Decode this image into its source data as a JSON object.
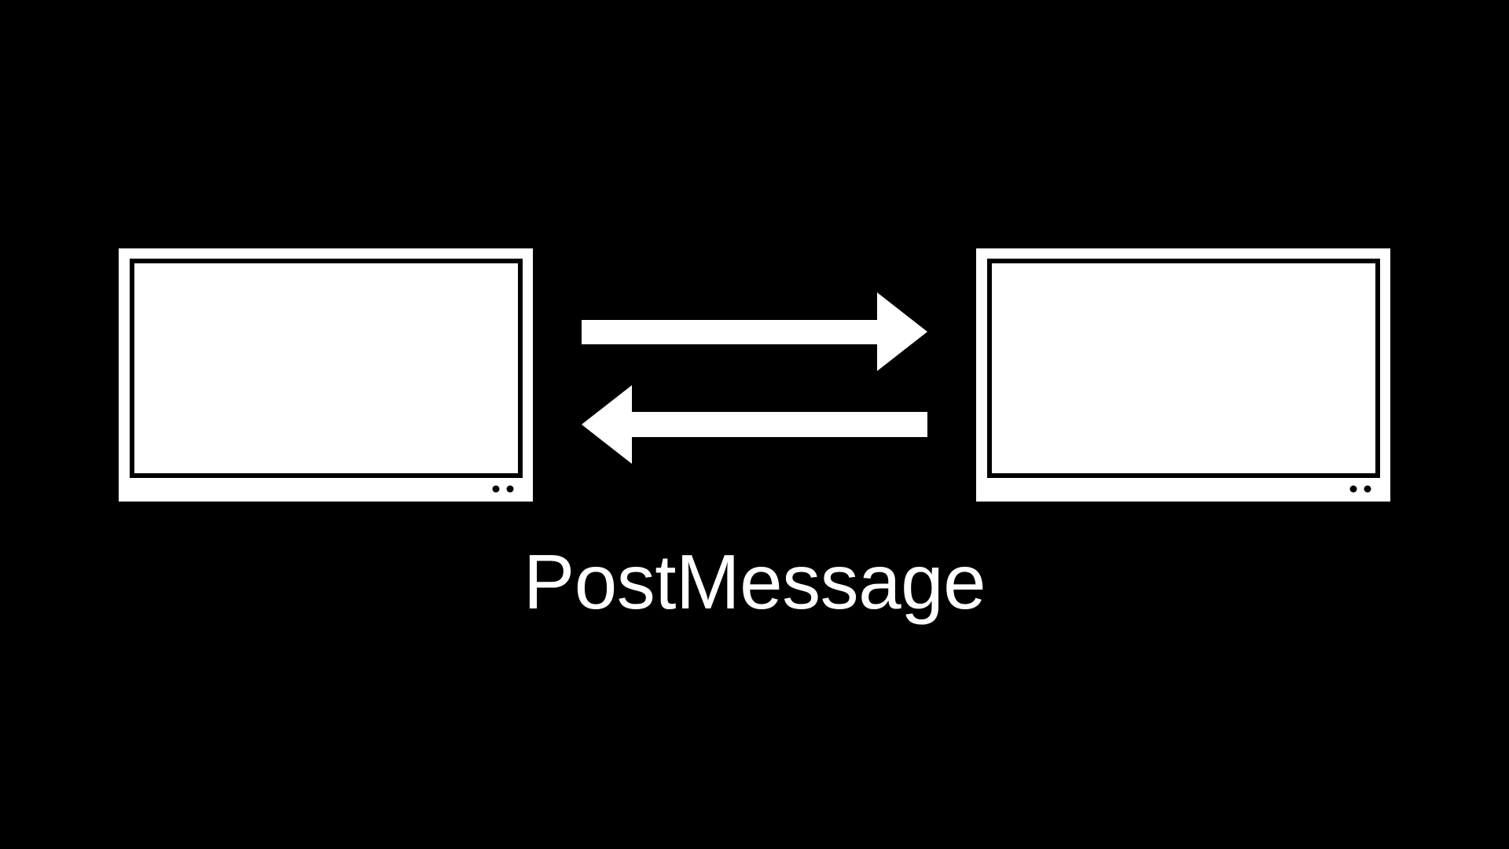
{
  "slide": {
    "caption": "PostMessage"
  },
  "diagram": {
    "nodes": [
      {
        "id": "window-left",
        "kind": "browser-window-icon"
      },
      {
        "id": "window-right",
        "kind": "browser-window-icon"
      }
    ],
    "edges": [
      {
        "from": "window-left",
        "to": "window-right",
        "direction": "right"
      },
      {
        "from": "window-right",
        "to": "window-left",
        "direction": "left"
      }
    ]
  },
  "colors": {
    "background": "#000000",
    "foreground": "#ffffff"
  }
}
